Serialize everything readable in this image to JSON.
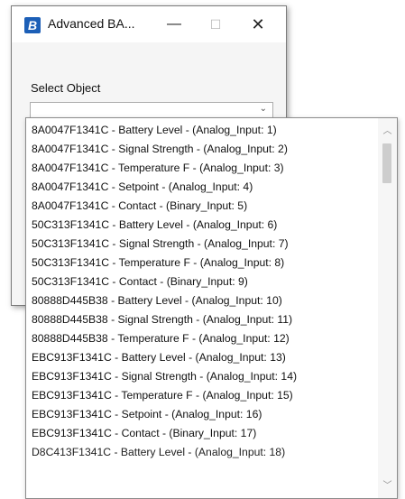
{
  "window": {
    "title": "Advanced BA...",
    "app_icon_glyph": "B",
    "controls": {
      "minimize": "—",
      "maximize": "☐",
      "close": "✕"
    }
  },
  "form": {
    "label": "Select Object",
    "selected_value": "",
    "arrow_glyph": "⌄"
  },
  "dropdown": {
    "items": [
      "8A0047F1341C - Battery Level - (Analog_Input: 1)",
      "8A0047F1341C - Signal Strength - (Analog_Input: 2)",
      "8A0047F1341C - Temperature F - (Analog_Input: 3)",
      "8A0047F1341C - Setpoint - (Analog_Input: 4)",
      "8A0047F1341C - Contact - (Binary_Input: 5)",
      "50C313F1341C - Battery Level - (Analog_Input: 6)",
      "50C313F1341C - Signal Strength - (Analog_Input: 7)",
      "50C313F1341C - Temperature F - (Analog_Input: 8)",
      "50C313F1341C - Contact - (Binary_Input: 9)",
      "80888D445B38 - Battery Level - (Analog_Input: 10)",
      "80888D445B38 - Signal Strength - (Analog_Input: 11)",
      "80888D445B38 - Temperature F - (Analog_Input: 12)",
      "EBC913F1341C - Battery Level - (Analog_Input: 13)",
      "EBC913F1341C - Signal Strength - (Analog_Input: 14)",
      "EBC913F1341C - Temperature F - (Analog_Input: 15)",
      "EBC913F1341C - Setpoint - (Analog_Input: 16)",
      "EBC913F1341C - Contact - (Binary_Input: 17)",
      "D8C413F1341C - Battery Level - (Analog_Input: 18)"
    ],
    "scroll_up_glyph": "︿",
    "scroll_down_glyph": "﹀",
    "scroll_position": 0.05
  }
}
